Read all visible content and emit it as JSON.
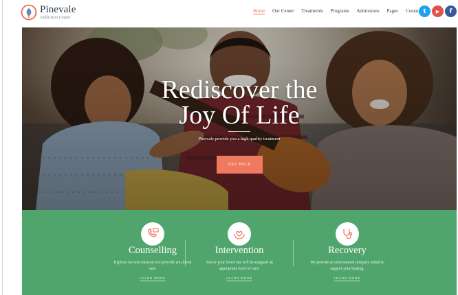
{
  "brand": {
    "name": "Pinevale",
    "tagline": "Addiction Center",
    "accent": "#ec6a52"
  },
  "nav": {
    "items": [
      {
        "label": "Home",
        "active": true
      },
      {
        "label": "Our Center",
        "active": false
      },
      {
        "label": "Treatments",
        "active": false
      },
      {
        "label": "Programs",
        "active": false
      },
      {
        "label": "Admissions",
        "active": false
      },
      {
        "label": "Pages",
        "active": false
      },
      {
        "label": "Contacts",
        "active": false
      }
    ]
  },
  "social": [
    {
      "icon": "twitter-icon",
      "glyph": "t",
      "color": "#1da1f2"
    },
    {
      "icon": "youtube-icon",
      "glyph": "▶",
      "color": "#e0524a"
    },
    {
      "icon": "facebook-icon",
      "glyph": "f",
      "color": "#3b5998"
    }
  ],
  "hero": {
    "title_line1": "Rediscover the",
    "title_line2": "Joy Of Life",
    "subtitle": "Pinevale provide you a high quality treatment",
    "cta_label": "GET HELP",
    "cta_color": "#f07a5f"
  },
  "features": {
    "bg_color": "#4fa56c",
    "items": [
      {
        "icon": "phone-chat-icon",
        "title": "Counselling",
        "description": "Explore our sole mission is to provide you loved one!",
        "link": "LEARN MORE"
      },
      {
        "icon": "heart-hands-icon",
        "title": "Intervention",
        "description": "You or your loved one will be assigned an appropriate level of care!",
        "link": "LEARN MORE"
      },
      {
        "icon": "stethoscope-icon",
        "title": "Recovery",
        "description": "We provide an environment uniquely suited to support your healing.",
        "link": "LEARN MORE"
      }
    ]
  }
}
